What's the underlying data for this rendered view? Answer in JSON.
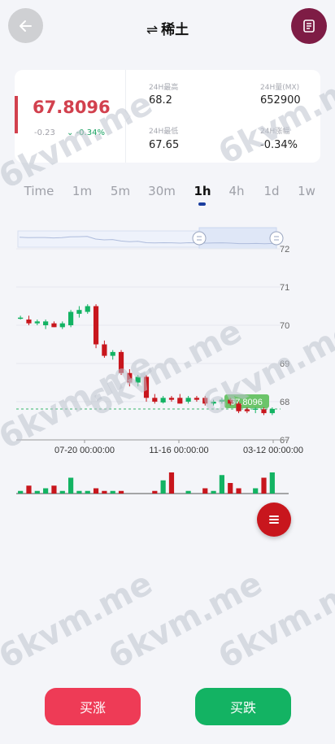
{
  "header": {
    "swap_symbol": "⇌",
    "title": "稀土"
  },
  "icons": {
    "back": "arrow-left-icon",
    "book": "book-icon",
    "menu": "menu-lines-icon"
  },
  "stats": {
    "price": "67.8096",
    "change_abs": "-0.23",
    "change_pct": "-0.34%",
    "change_arrow": "⌄",
    "high_label": "24H最高",
    "high_value": "68.2",
    "volume_label": "24H量(MX)",
    "volume_value": "652900",
    "low_label": "24H最低",
    "low_value": "67.65",
    "range_label": "24H涨幅",
    "range_value": "-0.34%"
  },
  "tabs": [
    "Time",
    "1m",
    "5m",
    "30m",
    "1h",
    "4h",
    "1d",
    "1w"
  ],
  "active_tab": "1h",
  "chart_data": {
    "type": "candlestick",
    "y_ticks": [
      "72",
      "71",
      "70",
      "69",
      "68",
      "67"
    ],
    "x_ticks": [
      "07-20 00:00:00",
      "11-16 00:00:00",
      "03-12 00:00:00"
    ],
    "ylim": [
      67,
      72
    ],
    "current_price": "67.8096",
    "candles": [
      {
        "o": 70.2,
        "h": 70.25,
        "l": 70.15,
        "c": 70.2
      },
      {
        "o": 70.15,
        "h": 70.25,
        "l": 70.0,
        "c": 70.05
      },
      {
        "o": 70.05,
        "h": 70.15,
        "l": 70.0,
        "c": 70.1
      },
      {
        "o": 70.0,
        "h": 70.15,
        "l": 69.9,
        "c": 70.1
      },
      {
        "o": 70.05,
        "h": 70.1,
        "l": 69.95,
        "c": 69.95
      },
      {
        "o": 69.95,
        "h": 70.1,
        "l": 69.9,
        "c": 70.05
      },
      {
        "o": 70.0,
        "h": 70.4,
        "l": 69.95,
        "c": 70.35
      },
      {
        "o": 70.3,
        "h": 70.5,
        "l": 70.2,
        "c": 70.4
      },
      {
        "o": 70.35,
        "h": 70.55,
        "l": 70.3,
        "c": 70.5
      },
      {
        "o": 70.5,
        "h": 70.55,
        "l": 69.4,
        "c": 69.5
      },
      {
        "o": 69.5,
        "h": 69.6,
        "l": 69.15,
        "c": 69.2
      },
      {
        "o": 69.2,
        "h": 69.35,
        "l": 69.1,
        "c": 69.3
      },
      {
        "o": 69.3,
        "h": 69.35,
        "l": 68.7,
        "c": 68.75
      },
      {
        "o": 68.75,
        "h": 68.85,
        "l": 68.4,
        "c": 68.5
      },
      {
        "o": 68.5,
        "h": 68.7,
        "l": 68.4,
        "c": 68.65
      },
      {
        "o": 68.65,
        "h": 68.7,
        "l": 68.0,
        "c": 68.1
      },
      {
        "o": 68.1,
        "h": 68.2,
        "l": 67.95,
        "c": 68.0
      },
      {
        "o": 67.98,
        "h": 68.15,
        "l": 67.95,
        "c": 68.1
      },
      {
        "o": 68.1,
        "h": 68.15,
        "l": 68.0,
        "c": 68.05
      },
      {
        "o": 68.1,
        "h": 68.2,
        "l": 67.95,
        "c": 67.95
      },
      {
        "o": 68.0,
        "h": 68.15,
        "l": 67.95,
        "c": 68.1
      },
      {
        "o": 68.1,
        "h": 68.15,
        "l": 68.0,
        "c": 68.05
      },
      {
        "o": 68.1,
        "h": 68.15,
        "l": 67.9,
        "c": 67.95
      },
      {
        "o": 67.95,
        "h": 68.05,
        "l": 67.9,
        "c": 68.0
      },
      {
        "o": 68.0,
        "h": 68.1,
        "l": 67.95,
        "c": 68.05
      },
      {
        "o": 68.05,
        "h": 68.1,
        "l": 67.9,
        "c": 67.95
      },
      {
        "o": 67.95,
        "h": 68.0,
        "l": 67.7,
        "c": 67.75
      },
      {
        "o": 67.8,
        "h": 67.85,
        "l": 67.7,
        "c": 67.75
      },
      {
        "o": 67.8,
        "h": 67.85,
        "l": 67.7,
        "c": 67.82
      },
      {
        "o": 67.8,
        "h": 67.85,
        "l": 67.65,
        "c": 67.7
      },
      {
        "o": 67.7,
        "h": 67.85,
        "l": 67.65,
        "c": 67.81
      }
    ],
    "volumes": [
      1,
      3,
      1,
      2,
      3,
      1,
      6,
      1,
      1,
      2,
      1,
      1,
      1,
      0,
      0,
      0,
      1,
      5,
      8,
      0,
      1,
      0,
      2,
      1,
      7,
      4,
      2,
      0,
      2,
      6,
      8
    ],
    "colors": {
      "up": "#13b363",
      "down": "#c8161d"
    }
  },
  "buttons": {
    "buy": "买涨",
    "sell": "买跌"
  },
  "watermark": "6kvm.me"
}
